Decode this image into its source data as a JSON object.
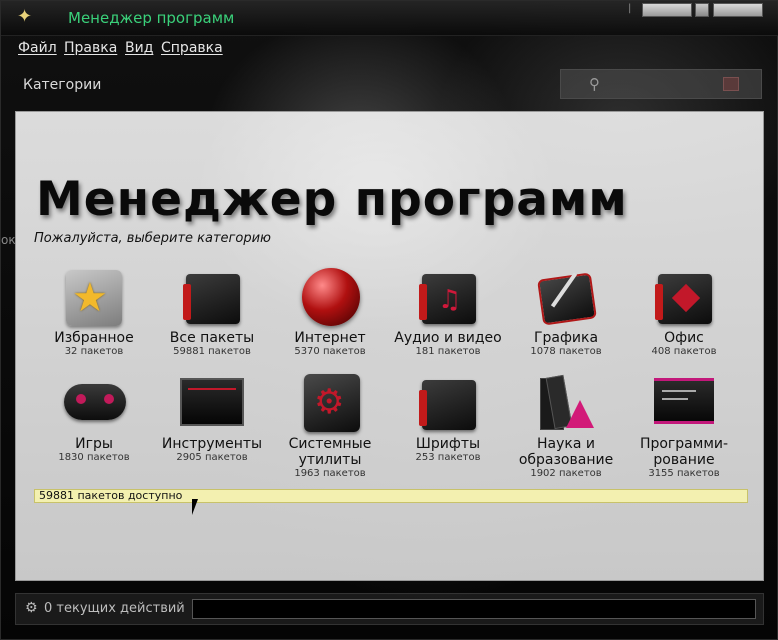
{
  "window": {
    "title": "Менеджер программ",
    "app_icon": "star-icon"
  },
  "menu": [
    {
      "label": "Файл"
    },
    {
      "label": "Правка"
    },
    {
      "label": "Вид"
    },
    {
      "label": "Справка"
    }
  ],
  "toolbar": {
    "categories_label": "Категории"
  },
  "main": {
    "title": "Менеджер программ",
    "subtitle": "Пожалуйста, выберите категорию",
    "categories": [
      {
        "name": "Избранное",
        "count": "32 пакетов",
        "icon": "star-icon"
      },
      {
        "name": "Все пакеты",
        "count": "59881 пакетов",
        "icon": "package-box-icon"
      },
      {
        "name": "Интернет",
        "count": "5370 пакетов",
        "icon": "globe-icon"
      },
      {
        "name": "Аудио и видео",
        "count": "181 пакетов",
        "icon": "music-icon"
      },
      {
        "name": "Графика",
        "count": "1078 пакетов",
        "icon": "graphics-tablet-icon"
      },
      {
        "name": "Офис",
        "count": "408 пакетов",
        "icon": "office-icon"
      },
      {
        "name": "Игры",
        "count": "1830 пакетов",
        "icon": "gamepad-icon"
      },
      {
        "name": "Инструменты",
        "count": "2905 пакетов",
        "icon": "monitor-icon"
      },
      {
        "name": "Системные утилиты",
        "count": "1963 пакетов",
        "icon": "gear-icon"
      },
      {
        "name": "Шрифты",
        "count": "253 пакетов",
        "icon": "font-box-icon"
      },
      {
        "name": "Наука и образование",
        "count": "1902 пакетов",
        "icon": "flask-icon"
      },
      {
        "name": "Программи-рование",
        "count": "3155 пакетов",
        "icon": "terminal-icon"
      }
    ],
    "status": "59881 пакетов доступно"
  },
  "bottom": {
    "actions": "0 текущих действий"
  },
  "colors": {
    "title_green": "#3ad17a",
    "accent_red": "#c21a1a",
    "status_yellow": "#f3f0b0"
  }
}
